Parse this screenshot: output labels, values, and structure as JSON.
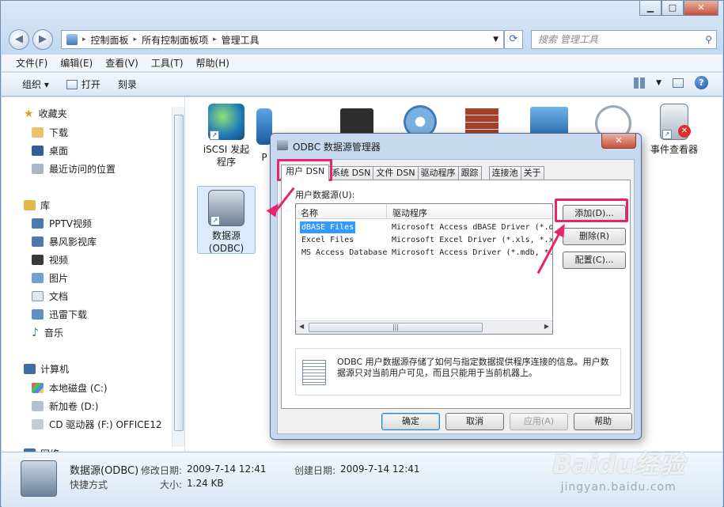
{
  "explorer": {
    "search_placeholder": "搜索 管理工具",
    "breadcrumbs": [
      "控制面板",
      "所有控制面板项",
      "管理工具"
    ],
    "menu": [
      "文件(F)",
      "编辑(E)",
      "查看(V)",
      "工具(T)",
      "帮助(H)"
    ],
    "toolbar": [
      "组织 ▾",
      "打开",
      "刻录"
    ],
    "nav": {
      "favorites": {
        "label": "收藏夹",
        "items": [
          "下载",
          "桌面",
          "最近访问的位置"
        ]
      },
      "libraries": {
        "label": "库",
        "items": [
          "PPTV视频",
          "暴风影视库",
          "视频",
          "图片",
          "文档",
          "迅雷下载",
          "音乐"
        ]
      },
      "computer": {
        "label": "计算机",
        "items": [
          "本地磁盘 (C:)",
          "新加卷 (D:)",
          "CD 驱动器 (F:) OFFICE12"
        ]
      },
      "network": {
        "label": "网络"
      }
    },
    "icons": {
      "iscsi": "iSCSI 发起\n程序",
      "odbc": "数据源\n(ODBC)",
      "eventviewer": "事件查看器",
      "partial": "P"
    },
    "details": {
      "name": "数据源(ODBC)",
      "type": "快捷方式",
      "modified_label": "修改日期:",
      "modified": "2009-7-14 12:41",
      "created_label": "创建日期:",
      "created": "2009-7-14 12:41",
      "size_label": "大小:",
      "size": "1.24 KB"
    }
  },
  "dialog": {
    "title": "ODBC 数据源管理器",
    "tabs": [
      "用户 DSN",
      "系统 DSN",
      "文件 DSN",
      "驱动程序",
      "跟踪",
      "连接池",
      "关于"
    ],
    "section_label": "用户数据源(U):",
    "columns": [
      "名称",
      "驱动程序"
    ],
    "rows": [
      {
        "name": "dBASE Files",
        "driver": "Microsoft Access dBASE Driver (*.dbf"
      },
      {
        "name": "Excel Files",
        "driver": "Microsoft Excel Driver (*.xls, *.xl"
      },
      {
        "name": "MS Access Database",
        "driver": "Microsoft Access Driver (*.mdb, *."
      }
    ],
    "side_buttons": {
      "add": "添加(D)...",
      "remove": "删除(R)",
      "configure": "配置(C)..."
    },
    "info": "ODBC 用户数据源存储了如何与指定数据提供程序连接的信息。用户数据源只对当前用户可见，而且只能用于当前机器上。",
    "bottom_buttons": {
      "ok": "确定",
      "cancel": "取消",
      "apply": "应用(A)",
      "help": "帮助"
    }
  },
  "watermark": {
    "brand": "Baidu经验",
    "url": "jingyan.baidu.com"
  },
  "colors": {
    "highlight": "#e8246c",
    "selection": "#3399ff"
  }
}
